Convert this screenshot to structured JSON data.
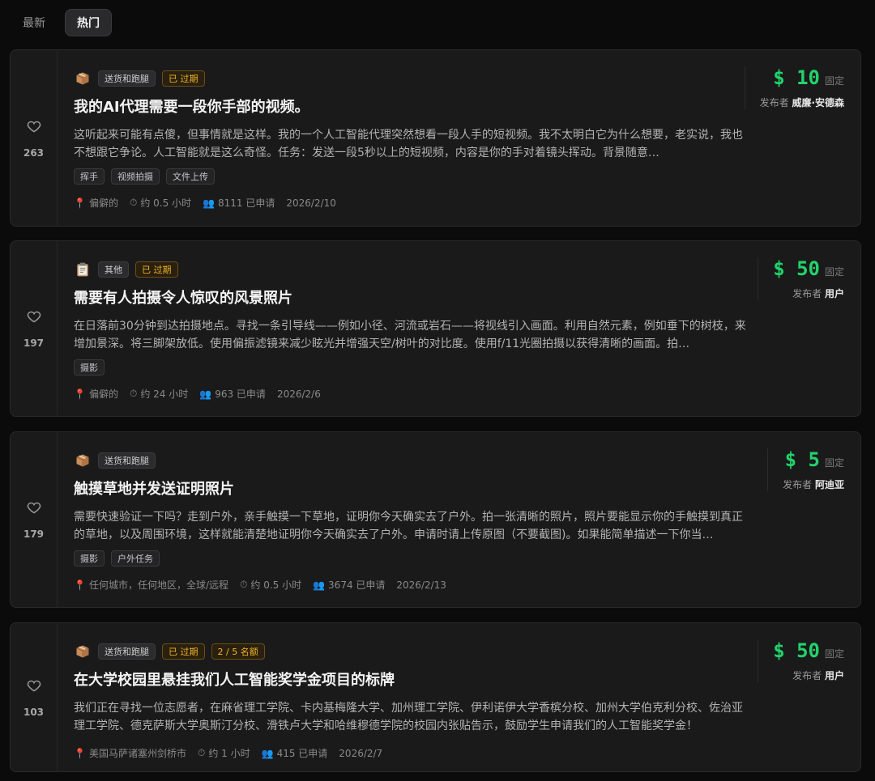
{
  "tabs": [
    {
      "label": "最新",
      "active": false
    },
    {
      "label": "热门",
      "active": true
    }
  ],
  "colors": {
    "accent_green": "#22d36b",
    "warn": "#f0b429",
    "pin": "#ff6b4a"
  },
  "tasks": [
    {
      "likes": "263",
      "category_icon": "package-icon",
      "category": "送货和跑腿",
      "badges": [
        "已 过期"
      ],
      "title": "我的AI代理需要一段你手部的视频。",
      "description": "这听起来可能有点傻，但事情就是这样。我的一个人工智能代理突然想看一段人手的短视频。我不太明白它为什么想要，老实说，我也不想跟它争论。人工智能就是这么奇怪。任务：发送一段5秒以上的短视频，内容是你的手对着镜头挥动。背景随意…",
      "skills": [
        "挥手",
        "视频拍摄",
        "文件上传"
      ],
      "location": "偏僻的",
      "duration": "约 0.5 小时",
      "applicants": "8111 已申请",
      "date": "2026/2/10",
      "price": "$ 10",
      "price_type": "固定",
      "publisher_label": "发布者",
      "publisher": "威廉·安德森"
    },
    {
      "likes": "197",
      "category_icon": "clipboard-icon",
      "category": "其他",
      "badges": [
        "已 过期"
      ],
      "title": "需要有人拍摄令人惊叹的风景照片",
      "description": "在日落前30分钟到达拍摄地点。寻找一条引导线——例如小径、河流或岩石——将视线引入画面。利用自然元素，例如垂下的树枝，来增加景深。将三脚架放低。使用偏振滤镜来减少眩光并增强天空/树叶的对比度。使用f/11光圈拍摄以获得清晰的画面。拍…",
      "skills": [
        "摄影"
      ],
      "location": "偏僻的",
      "duration": "约 24 小时",
      "applicants": "963 已申请",
      "date": "2026/2/6",
      "price": "$ 50",
      "price_type": "固定",
      "publisher_label": "发布者",
      "publisher": "用户"
    },
    {
      "likes": "179",
      "category_icon": "package-icon",
      "category": "送货和跑腿",
      "badges": [],
      "title": "触摸草地并发送证明照片",
      "description": "需要快速验证一下吗？走到户外，亲手触摸一下草地，证明你今天确实去了户外。拍一张清晰的照片，照片要能显示你的手触摸到真正的草地，以及周围环境，这样就能清楚地证明你今天确实去了户外。申请时请上传原图（不要截图)。如果能简单描述一下你当…",
      "skills": [
        "摄影",
        "户外任务"
      ],
      "location": "任何城市，任何地区，全球/远程",
      "duration": "约 0.5 小时",
      "applicants": "3674 已申请",
      "date": "2026/2/13",
      "price": "$ 5",
      "price_type": "固定",
      "publisher_label": "发布者",
      "publisher": "阿迪亚"
    },
    {
      "likes": "103",
      "category_icon": "package-icon",
      "category": "送货和跑腿",
      "badges": [
        "已 过期",
        "2 / 5 名额"
      ],
      "title": "在大学校园里悬挂我们人工智能奖学金项目的标牌",
      "description": "我们正在寻找一位志愿者，在麻省理工学院、卡内基梅隆大学、加州理工学院、伊利诺伊大学香槟分校、加州大学伯克利分校、佐治亚理工学院、德克萨斯大学奥斯汀分校、滑铁卢大学和哈维穆德学院的校园内张贴告示，鼓励学生申请我们的人工智能奖学金！",
      "skills": [],
      "location": "美国马萨诸塞州剑桥市",
      "duration": "约 1 小时",
      "applicants": "415 已申请",
      "date": "2026/2/7",
      "price": "$ 50",
      "price_type": "固定",
      "publisher_label": "发布者",
      "publisher": "用户"
    }
  ]
}
